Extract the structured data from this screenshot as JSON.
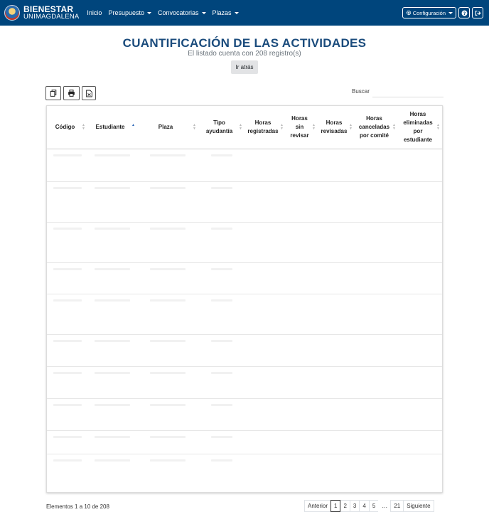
{
  "brand": {
    "line1": "BIENESTAR",
    "line2": "UNIMAGDALENA"
  },
  "nav": {
    "items": [
      {
        "label": "Inicio",
        "dropdown": false
      },
      {
        "label": "Presupuesto",
        "dropdown": true
      },
      {
        "label": "Convocatorias",
        "dropdown": true
      },
      {
        "label": "Plazas",
        "dropdown": true
      }
    ],
    "config_label": "Configuración",
    "config_icon": "gear-icon",
    "help_icon": "question-icon",
    "logout_icon": "sign-out-icon"
  },
  "header": {
    "title": "CUANTIFICACIÓN DE LAS ACTIVIDADES",
    "subtitle": "El listado cuenta con 208 registro(s)",
    "back_label": "Ir atrás"
  },
  "toolbar": {
    "icons": [
      "copy-icon",
      "print-icon",
      "export-file-icon"
    ],
    "search_label": "Buscar",
    "search_value": ""
  },
  "table": {
    "columns": [
      {
        "label": "Código",
        "sort": "none"
      },
      {
        "label": "Estudiante",
        "sort": "asc"
      },
      {
        "label": "Plaza",
        "sort": "none"
      },
      {
        "label": "Tipo ayudantía",
        "sort": "none"
      },
      {
        "label": "Horas registradas",
        "sort": "none"
      },
      {
        "label": "Horas sin revisar",
        "sort": "none"
      },
      {
        "label": "Horas revisadas",
        "sort": "none"
      },
      {
        "label": "Horas canceladas por comité",
        "sort": "none"
      },
      {
        "label": "Horas eliminadas por estudiante",
        "sort": "none"
      }
    ],
    "row_count": 10
  },
  "footer": {
    "info": "Elementos 1 a 10 de 208",
    "pagination": [
      "Anterior",
      "1",
      "2",
      "3",
      "4",
      "5",
      "…",
      "21",
      "Siguiente"
    ],
    "active_page": "1"
  },
  "colors": {
    "navbar": "#00457c",
    "title": "#1a4b7c",
    "sort_active": "#2a66b8"
  }
}
